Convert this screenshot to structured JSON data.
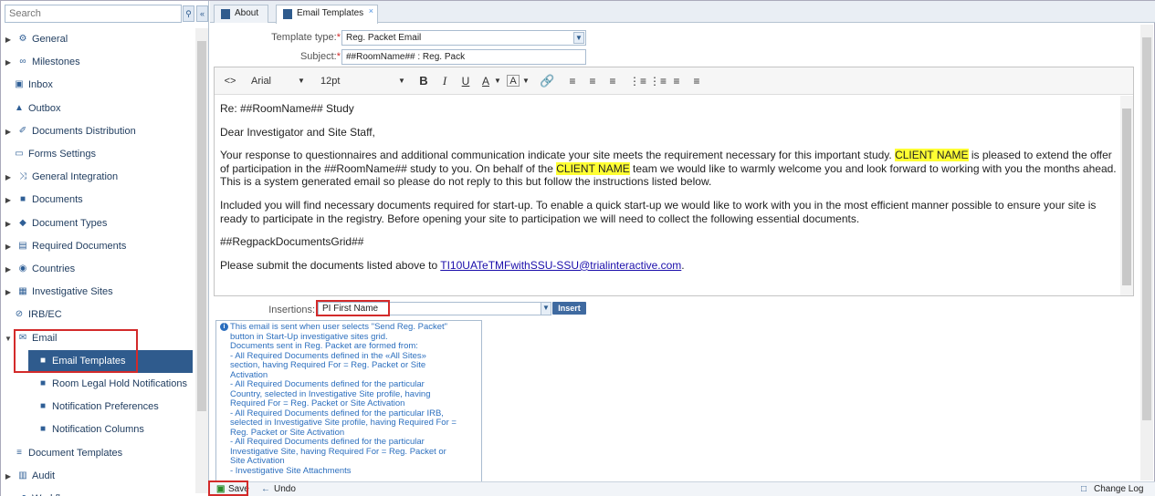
{
  "sidebar": {
    "search_placeholder": "Search",
    "search_icon": "search-icon",
    "collapse_icon": "double-chevron-left-icon",
    "items": [
      {
        "label": "General",
        "icon": "gears-icon",
        "expandable": true
      },
      {
        "label": "Milestones",
        "icon": "link-icon",
        "expandable": true
      },
      {
        "label": "Inbox",
        "icon": "inbox-icon",
        "expandable": false
      },
      {
        "label": "Outbox",
        "icon": "outbox-icon",
        "expandable": false
      },
      {
        "label": "Documents Distribution",
        "icon": "paperclip-icon",
        "expandable": true
      },
      {
        "label": "Forms Settings",
        "icon": "window-icon",
        "expandable": false
      },
      {
        "label": "General Integration",
        "icon": "shuffle-icon",
        "expandable": true
      },
      {
        "label": "Documents",
        "icon": "document-icon",
        "expandable": true
      },
      {
        "label": "Document Types",
        "icon": "tag-icon",
        "expandable": true
      },
      {
        "label": "Required Documents",
        "icon": "required-document-icon",
        "expandable": true
      },
      {
        "label": "Countries",
        "icon": "globe-icon",
        "expandable": true
      },
      {
        "label": "Investigative Sites",
        "icon": "sites-icon",
        "expandable": true
      },
      {
        "label": "IRB/EC",
        "icon": "irb-icon",
        "expandable": false
      },
      {
        "label": "Email",
        "icon": "envelope-icon",
        "expandable": true,
        "expanded": true
      },
      {
        "label": "Email Templates",
        "icon": "document-icon",
        "selected": true
      },
      {
        "label": "Room Legal Hold Notifications",
        "icon": "document-icon"
      },
      {
        "label": "Notification Preferences",
        "icon": "document-icon"
      },
      {
        "label": "Notification Columns",
        "icon": "document-icon"
      },
      {
        "label": "Document Templates",
        "icon": "list-icon",
        "expandable": false
      },
      {
        "label": "Audit",
        "icon": "audit-icon",
        "expandable": true
      },
      {
        "label": "Workflows",
        "icon": "workflow-icon",
        "expandable": true
      }
    ]
  },
  "tabs": [
    {
      "label": "About",
      "active": false
    },
    {
      "label": "Email Templates",
      "active": true,
      "close": "×"
    }
  ],
  "form": {
    "template_type_label": "Template type:",
    "template_type_value": "Reg. Packet Email",
    "subject_label": "Subject:",
    "subject_value": "##RoomName## : Reg. Pack",
    "required_mark": "*"
  },
  "toolbar": {
    "source": "<>",
    "font_family": "Arial",
    "font_size": "12pt",
    "bold": "B",
    "italic": "I",
    "underline": "U",
    "font_color": "A",
    "bg_color": "A"
  },
  "email": {
    "p1": "Re: ##RoomName## Study",
    "p2": "Dear Investigator and Site Staff,",
    "p3a": "Your response to questionnaires and additional communication indicate your site meets the requirement necessary for this important study. ",
    "p3hl1": "CLIENT NAME",
    "p3b": " is pleased to extend the offer of participation in the ##RoomName## study to you.  On behalf of the ",
    "p3hl2": "CLIENT NAME",
    "p3c": " team we would like to warmly welcome you and look forward to working with you the months ahead.  This is a system generated email so please do not reply to this but follow the instructions listed below.",
    "p4": "Included you will find necessary documents required for start-up.  To enable a quick start-up we would like to work with you in the most efficient manner possible to ensure your site is ready to participate in the registry. Before opening your site to participation we will need to collect the following essential documents.",
    "p5": "##RegpackDocumentsGrid##",
    "p6a": "Please submit the documents listed above to ",
    "p6link": "TI10UATeTMFwithSSU-SSU@trialinteractive.com",
    "p6b": "."
  },
  "insertions": {
    "label": "Insertions:",
    "value": "PI First Name",
    "button": "Insert"
  },
  "info_lines": [
    "This email is sent when user selects \"Send Reg. Packet\"",
    "button in Start-Up investigative sites grid.",
    "Documents sent in Reg. Packet are formed from:",
    "- All Required Documents defined in the «All Sites»",
    "section, having Required For = Reg. Packet or Site",
    "Activation",
    "- All Required Documents defined for the particular",
    "Country, selected in Investigative Site profile, having",
    "Required For = Reg. Packet or Site Activation",
    "- All Required Documents defined for the particular IRB,",
    "selected in Investigative Site profile, having Required For =",
    "Reg. Packet or Site Activation",
    "- All Required Documents defined for the particular",
    "Investigative Site, having Required For = Reg. Packet or",
    "Site Activation",
    "- Investigative Site Attachments"
  ],
  "bottom": {
    "save": "Save",
    "undo": "Undo",
    "change_log": "Change Log"
  },
  "colors": {
    "accent": "#2f5b8d",
    "highlight": "#ffff33",
    "annotation_box": "#d32a2a",
    "info_text": "#2c6fbe"
  }
}
